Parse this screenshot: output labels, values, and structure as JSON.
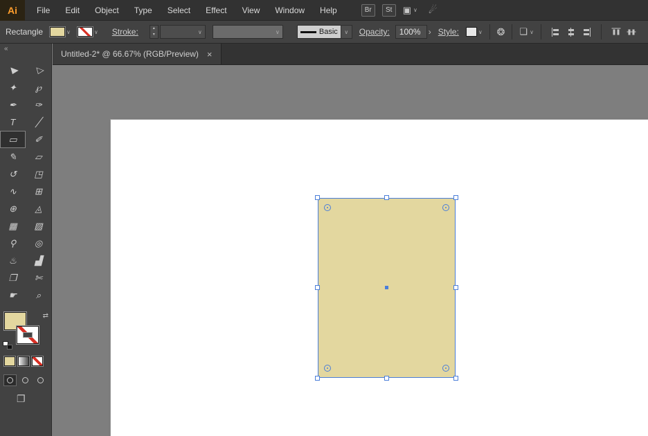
{
  "app": {
    "logo_text": "Ai"
  },
  "menu": {
    "items": [
      "File",
      "Edit",
      "Object",
      "Type",
      "Select",
      "Effect",
      "View",
      "Window",
      "Help"
    ]
  },
  "header_buttons": {
    "bridge": "Br",
    "stock": "St"
  },
  "icons": {
    "arrange_documents": "▣",
    "touch_workspace": "☄",
    "chevron_down": "∨",
    "stepper_up": "▴",
    "stepper_down": "▾",
    "opacity_chevron": "›",
    "recolor_artwork": "❂",
    "align_to": "❏",
    "collapse_panel": "«",
    "swap_fill_stroke": "⇄",
    "screen_mode": "❐",
    "close_tab": "×"
  },
  "control_bar": {
    "context_label": "Rectangle",
    "stroke_label": "Stroke:",
    "brush_definition": "Basic",
    "opacity_label": "Opacity:",
    "opacity_value": "100%",
    "style_label": "Style:"
  },
  "document_tab": {
    "title": "Untitled-2* @ 66.67% (RGB/Preview)"
  },
  "toolbar": {
    "tools": [
      {
        "name": "selection",
        "glyph": "▶"
      },
      {
        "name": "direct-selection",
        "glyph": "▷"
      },
      {
        "name": "magic-wand",
        "glyph": "✦"
      },
      {
        "name": "lasso",
        "glyph": "℘"
      },
      {
        "name": "pen",
        "glyph": "✒"
      },
      {
        "name": "curvature",
        "glyph": "✑"
      },
      {
        "name": "type",
        "glyph": "T"
      },
      {
        "name": "line-segment",
        "glyph": "╱"
      },
      {
        "name": "rectangle",
        "glyph": "▭"
      },
      {
        "name": "paintbrush",
        "glyph": "✐"
      },
      {
        "name": "shaper",
        "glyph": "✎"
      },
      {
        "name": "eraser",
        "glyph": "▱"
      },
      {
        "name": "rotate",
        "glyph": "↺"
      },
      {
        "name": "scale",
        "glyph": "◳"
      },
      {
        "name": "width",
        "glyph": "∿"
      },
      {
        "name": "free-transform",
        "glyph": "⊞"
      },
      {
        "name": "shape-builder",
        "glyph": "⊕"
      },
      {
        "name": "perspective-grid",
        "glyph": "◬"
      },
      {
        "name": "mesh",
        "glyph": "▦"
      },
      {
        "name": "gradient",
        "glyph": "▧"
      },
      {
        "name": "eyedropper",
        "glyph": "⚲"
      },
      {
        "name": "blend",
        "glyph": "◎"
      },
      {
        "name": "symbol-sprayer",
        "glyph": "♨"
      },
      {
        "name": "column-graph",
        "glyph": "▟"
      },
      {
        "name": "artboard",
        "glyph": "❒"
      },
      {
        "name": "slice",
        "glyph": "✄"
      },
      {
        "name": "hand",
        "glyph": "☛"
      },
      {
        "name": "zoom",
        "glyph": "⌕"
      }
    ],
    "selected_tool": "rectangle"
  },
  "colors": {
    "fill": "#e3d79f",
    "selection_blue": "#4a7ed9",
    "pasteboard_gray": "#7e7e7e",
    "artboard_white": "#ffffff",
    "none_slash_red": "#d93025"
  },
  "canvas": {
    "zoom_level": "66.67%",
    "rectangle_fill": "#e3d79f"
  }
}
